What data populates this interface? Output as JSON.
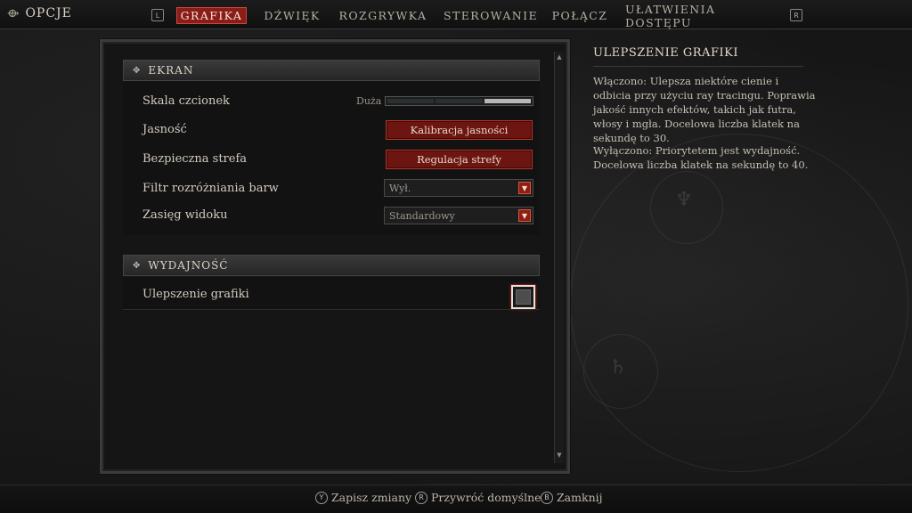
{
  "header": {
    "title": "OPCJE",
    "left_hint": "L",
    "right_hint": "R",
    "tabs": [
      {
        "label": "GRAFIKA"
      },
      {
        "label": "DŹWIĘK"
      },
      {
        "label": "ROZGRYWKA"
      },
      {
        "label": "STEROWANIE"
      },
      {
        "label": "POŁĄCZ"
      },
      {
        "label": "UŁATWIENIA DOSTĘPU"
      }
    ]
  },
  "ekran": {
    "heading": "EKRAN",
    "font_scale": {
      "label": "Skala czcionek",
      "value": "Duża",
      "level": 3,
      "levels": 3
    },
    "brightness": {
      "label": "Jasność",
      "button": "Kalibracja jasności"
    },
    "safe_zone": {
      "label": "Bezpieczna strefa",
      "button": "Regulacja strefy"
    },
    "color_filter": {
      "label": "Filtr rozróżniania barw",
      "value": "Wył."
    },
    "view_distance": {
      "label": "Zasięg widoku",
      "value": "Standardowy"
    }
  },
  "wydajnosc": {
    "heading": "WYDAJNOŚĆ",
    "graphics_boost": {
      "label": "Ulepszenie grafiki",
      "checked": false
    }
  },
  "description": {
    "title": "ULEPSZENIE GRAFIKI",
    "on_text": "Włączono: Ulepsza niektóre cienie i odbicia przy użyciu ray tracingu. Poprawia jakość innych efektów, takich jak futra, włosy i mgła. Docelowa liczba klatek na sekundę to 30.",
    "off_text": "Wyłączono: Priorytetem jest wydajność. Docelowa liczba klatek na sekundę to 40."
  },
  "footer": {
    "save": {
      "key": "Y",
      "label": "Zapisz zmiany"
    },
    "reset": {
      "key": "R",
      "label": "Przywróć domyślne"
    },
    "close": {
      "key": "B",
      "label": "Zamknij"
    }
  },
  "colors": {
    "accent_red": "#8c1c18",
    "text": "#c9c2b8"
  }
}
